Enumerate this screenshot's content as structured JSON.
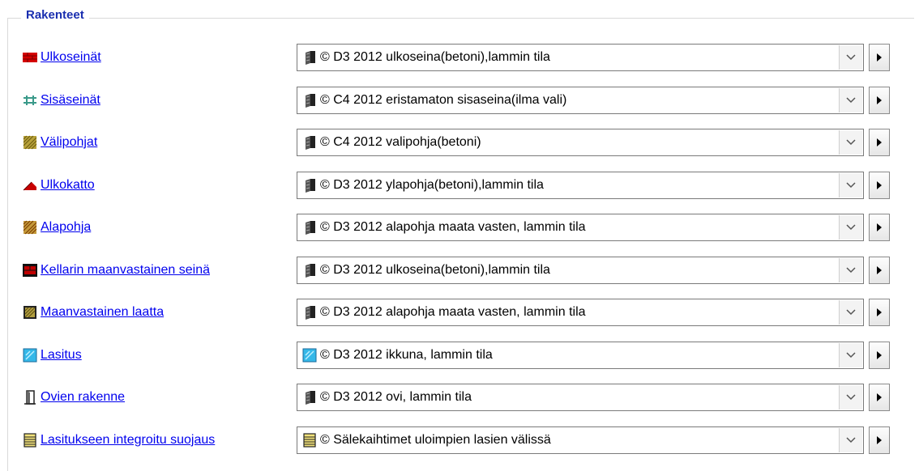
{
  "group_title": "Rakenteet",
  "rows": [
    {
      "label": "Ulkoseinät",
      "label_icon": "red-brick-wall-icon",
      "value": "© D3 2012 ulkoseina(betoni),lammin tila",
      "value_icon": "layered-structure-icon"
    },
    {
      "label": "Sisäseinät",
      "label_icon": "inner-wall-icon",
      "value": "© C4 2012 eristamaton sisaseina(ilma vali)",
      "value_icon": "layered-structure-icon"
    },
    {
      "label": "Välipohjat",
      "label_icon": "floor-slab-icon",
      "value": "© C4 2012 valipohja(betoni)",
      "value_icon": "layered-structure-icon"
    },
    {
      "label": "Ulkokatto",
      "label_icon": "roof-icon",
      "value": "© D3 2012 ylapohja(betoni),lammin tila",
      "value_icon": "layered-structure-icon"
    },
    {
      "label": "Alapohja",
      "label_icon": "base-floor-icon",
      "value": "© D3 2012 alapohja maata vasten, lammin tila",
      "value_icon": "layered-structure-icon"
    },
    {
      "label": "Kellarin maanvastainen seinä",
      "label_icon": "basement-wall-icon",
      "value": "© D3 2012 ulkoseina(betoni),lammin tila",
      "value_icon": "layered-structure-icon"
    },
    {
      "label": "Maanvastainen laatta",
      "label_icon": "ground-slab-icon",
      "value": "© D3 2012 alapohja maata vasten, lammin tila",
      "value_icon": "layered-structure-icon"
    },
    {
      "label": "Lasitus",
      "label_icon": "glass-icon",
      "value": "© D3 2012 ikkuna, lammin tila",
      "value_icon": "window-glass-icon"
    },
    {
      "label": "Ovien rakenne",
      "label_icon": "door-icon",
      "value": "© D3 2012 ovi, lammin tila",
      "value_icon": "layered-structure-icon"
    },
    {
      "label": "Lasitukseen integroitu suojaus",
      "label_icon": "blinds-icon",
      "value": "© Sälekaihtimet uloimpien lasien välissä",
      "value_icon": "blinds-icon"
    }
  ]
}
